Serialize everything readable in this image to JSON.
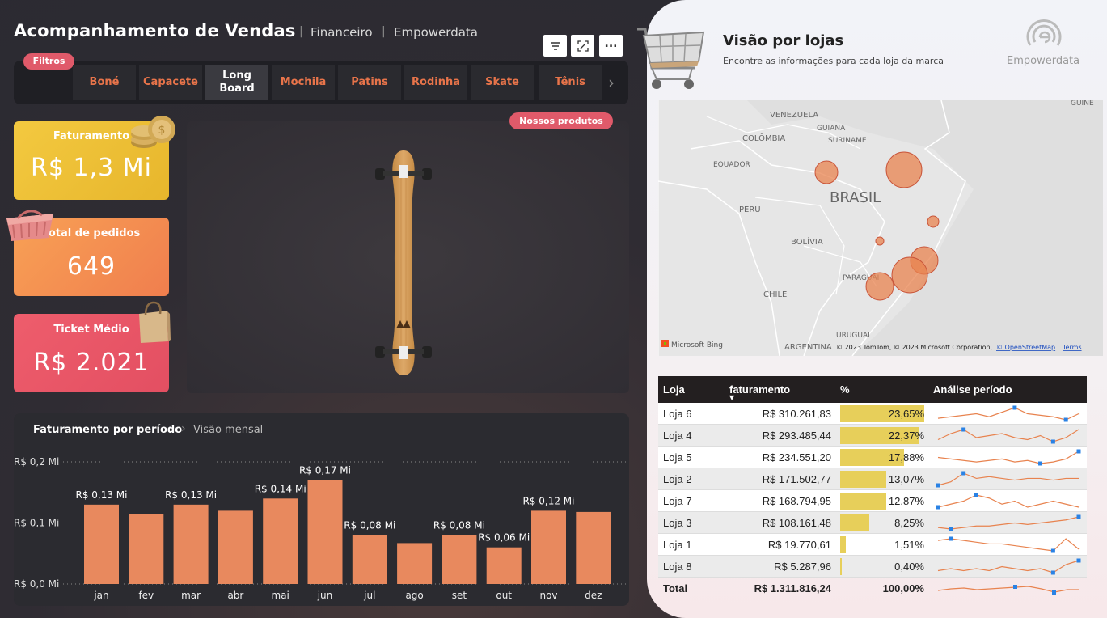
{
  "header": {
    "title": "Acompanhamento de Vendas",
    "crumb1": "Financeiro",
    "crumb2": "Empowerdata"
  },
  "filters": {
    "label": "Filtros",
    "tabs": [
      "Boné",
      "Capacete",
      "Long Board",
      "Mochila",
      "Patins",
      "Rodinha",
      "Skate",
      "Tênis"
    ],
    "active": "Long Board"
  },
  "kpis": {
    "faturamento": {
      "label": "Faturamento",
      "value": "R$ 1,3 Mi",
      "color": "#f0c43c"
    },
    "pedidos": {
      "label": "Total de pedidos",
      "value": "649",
      "color": "#f28a4e"
    },
    "ticket": {
      "label": "Ticket Médio",
      "value": "R$ 2.021",
      "color": "#e8566a"
    }
  },
  "product": {
    "badge": "Nossos produtos"
  },
  "chart": {
    "title": "Faturamento por período",
    "crumb": "Visão mensal"
  },
  "chart_data": {
    "type": "bar",
    "categories": [
      "jan",
      "fev",
      "mar",
      "abr",
      "mai",
      "jun",
      "jul",
      "ago",
      "set",
      "out",
      "nov",
      "dez"
    ],
    "values": [
      0.13,
      0.115,
      0.13,
      0.12,
      0.14,
      0.17,
      0.08,
      0.067,
      0.08,
      0.06,
      0.12,
      0.118
    ],
    "labels": [
      "R$ 0,13 Mi",
      "",
      "R$ 0,13 Mi",
      "",
      "R$ 0,14 Mi",
      "R$ 0,17 Mi",
      "R$ 0,08 Mi",
      "",
      "R$ 0,08 Mi",
      "R$ 0,06 Mi",
      "R$ 0,12 Mi",
      ""
    ],
    "yticks": [
      "R$ 0,0 Mi",
      "R$ 0,1 Mi",
      "R$ 0,2 Mi"
    ],
    "ylim": [
      0,
      0.2
    ],
    "grid": true,
    "bar_color": "#e8895e"
  },
  "stores": {
    "title": "Visão por lojas",
    "subtitle": "Encontre as informações para cada loja da marca",
    "logo": "Empowerdata",
    "map": {
      "countries": [
        "VENEZUELA",
        "GUIANA",
        "SURINAME",
        "COLÔMBIA",
        "EQUADOR",
        "BRASIL",
        "PERU",
        "BOLÍVIA",
        "PARAGUAI",
        "CHILE",
        "URUGUAI",
        "ARGENTINA",
        "GUINÉ"
      ],
      "attribution": "© 2023 TomTom, © 2023 Microsoft Corporation,",
      "osm": "© OpenStreetMap",
      "terms": "Terms",
      "bing": "Microsoft Bing"
    },
    "table": {
      "headers": [
        "Loja",
        "faturamento",
        "%",
        "Análise período"
      ],
      "rows": [
        {
          "loja": "Loja 6",
          "fat": "R$ 310.261,83",
          "pct": "23,65%",
          "v": 23.65
        },
        {
          "loja": "Loja 4",
          "fat": "R$ 293.485,44",
          "pct": "22,37%",
          "v": 22.37
        },
        {
          "loja": "Loja 5",
          "fat": "R$ 234.551,20",
          "pct": "17,88%",
          "v": 17.88
        },
        {
          "loja": "Loja 2",
          "fat": "R$ 171.502,77",
          "pct": "13,07%",
          "v": 13.07
        },
        {
          "loja": "Loja 7",
          "fat": "R$ 168.794,95",
          "pct": "12,87%",
          "v": 12.87
        },
        {
          "loja": "Loja 3",
          "fat": "R$ 108.161,48",
          "pct": "8,25%",
          "v": 8.25
        },
        {
          "loja": "Loja 1",
          "fat": "R$ 19.770,61",
          "pct": "1,51%",
          "v": 1.51
        },
        {
          "loja": "Loja 8",
          "fat": "R$ 5.287,96",
          "pct": "0,40%",
          "v": 0.4
        }
      ],
      "total": {
        "loja": "Total",
        "fat": "R$ 1.311.816,24",
        "pct": "100,00%"
      }
    }
  }
}
